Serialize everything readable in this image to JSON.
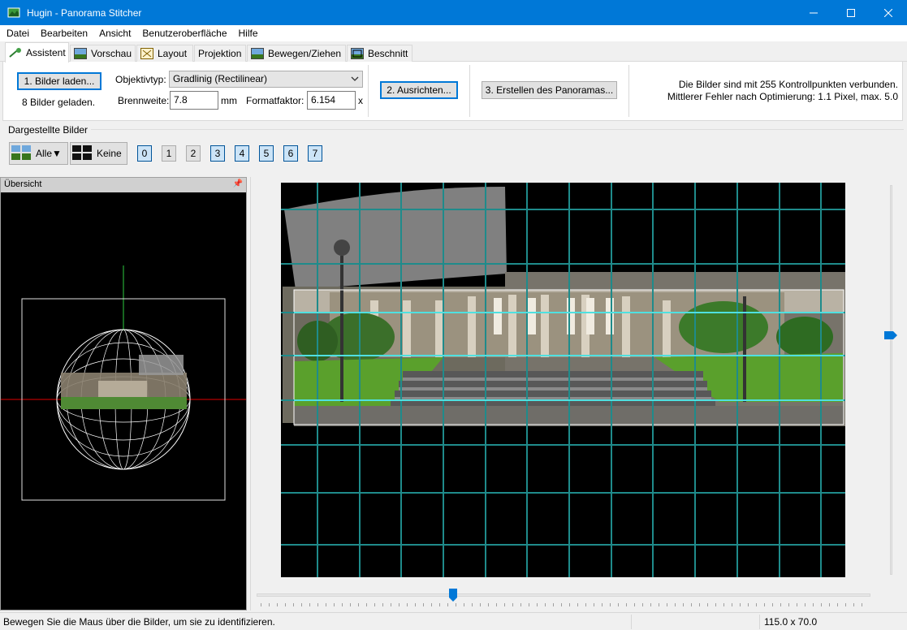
{
  "window": {
    "title": "Hugin - Panorama Stitcher"
  },
  "menu": {
    "items": [
      "Datei",
      "Bearbeiten",
      "Ansicht",
      "Benutzeroberfläche",
      "Hilfe"
    ]
  },
  "tabs": [
    {
      "label": "Assistent",
      "icon": "wizard-icon",
      "active": true
    },
    {
      "label": "Vorschau",
      "icon": "preview-icon"
    },
    {
      "label": "Layout",
      "icon": "layout-icon"
    },
    {
      "label": "Projektion",
      "icon": "projection-icon"
    },
    {
      "label": "Bewegen/Ziehen",
      "icon": "move-drag-icon"
    },
    {
      "label": "Beschnitt",
      "icon": "crop-icon"
    }
  ],
  "assistant": {
    "load_button": "1. Bilder laden...",
    "loaded_text": "8 Bilder geladen.",
    "lens_type_label": "Objektivtyp:",
    "lens_type_value": "Gradlinig (Rectilinear)",
    "focal_length_label": "Brennweite:",
    "focal_length_value": "7.8",
    "focal_length_unit": "mm",
    "crop_factor_label": "Formatfaktor:",
    "crop_factor_value": "6.154",
    "crop_factor_unit": "x",
    "align_button": "2. Ausrichten...",
    "create_button": "3. Erstellen des Panoramas...",
    "info_line1": "Die Bilder sind mit 255 Kontrollpunkten verbunden.",
    "info_line2": "Mittlerer Fehler nach Optimierung: 1.1 Pixel, max. 5.0"
  },
  "displayed_images": {
    "label": "Dargestellte Bilder",
    "all_button": "Alle▼",
    "none_button": "Keine",
    "images": [
      {
        "label": "0",
        "on": true
      },
      {
        "label": "1",
        "on": false
      },
      {
        "label": "2",
        "on": false
      },
      {
        "label": "3",
        "on": true
      },
      {
        "label": "4",
        "on": true
      },
      {
        "label": "5",
        "on": true
      },
      {
        "label": "6",
        "on": true
      },
      {
        "label": "7",
        "on": true
      }
    ]
  },
  "overview": {
    "title": "Übersicht"
  },
  "status": {
    "message": "Bewegen Sie die Maus über die Bilder, um sie zu identifizieren.",
    "fov": "115.0 x 70.0"
  },
  "colors": {
    "titlebar": "#0078d7",
    "grid": "#1f8b8b",
    "focus": "#0078d7"
  }
}
